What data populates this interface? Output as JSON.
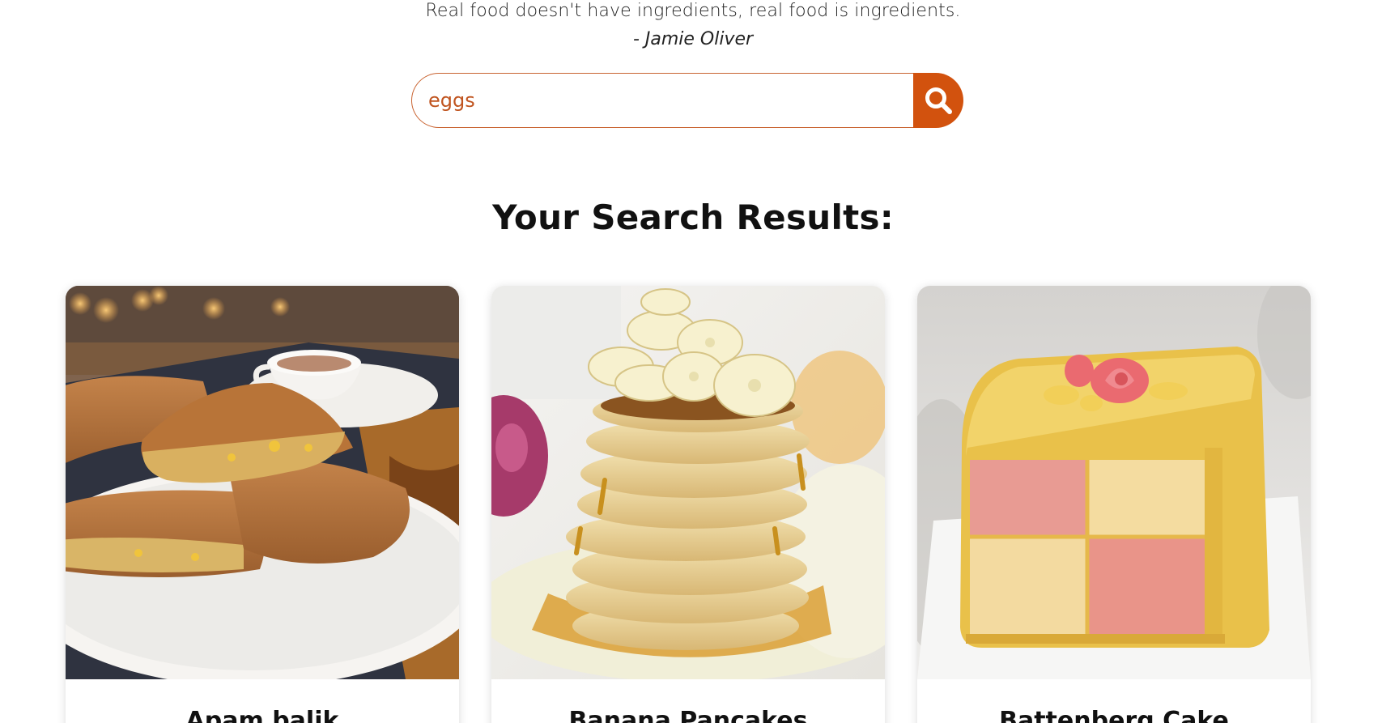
{
  "quote": {
    "text": "Real food doesn't have ingredients, real food is ingredients.",
    "author": "- Jamie Oliver"
  },
  "search": {
    "value": "eggs",
    "button_icon": "search-icon"
  },
  "results": {
    "title": "Your Search Results:",
    "cards": [
      {
        "title": "Apam balik",
        "image": "apam-balik-photo"
      },
      {
        "title": "Banana Pancakes",
        "image": "banana-pancakes-photo"
      },
      {
        "title": "Battenberg Cake",
        "image": "battenberg-cake-photo"
      }
    ]
  },
  "colors": {
    "accent": "#d2520e",
    "input_border": "#c96432",
    "input_text": "#c0541f"
  }
}
